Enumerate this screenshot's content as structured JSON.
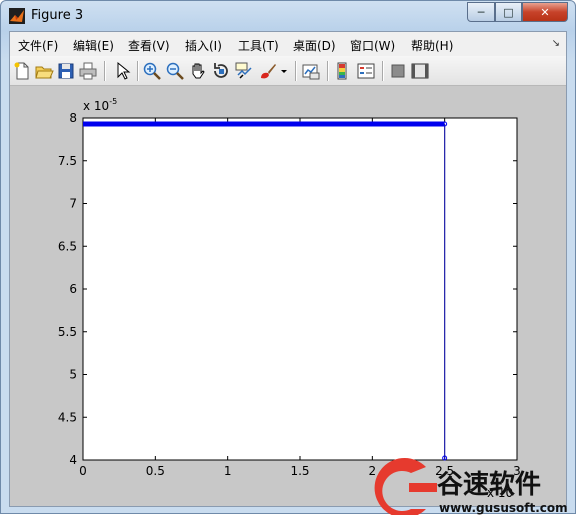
{
  "window": {
    "title": "Figure 3",
    "controls": {
      "minimize": "─",
      "maximize": "□",
      "close": "✕"
    }
  },
  "menu": {
    "items": [
      "文件(F)",
      "编辑(E)",
      "查看(V)",
      "插入(I)",
      "工具(T)",
      "桌面(D)",
      "窗口(W)",
      "帮助(H)"
    ],
    "overflow_icon": "dock-arrow-icon"
  },
  "toolbar": {
    "buttons": [
      "new-figure-icon",
      "open-file-icon",
      "save-icon",
      "print-icon",
      "edit-plot-arrow-icon",
      "zoom-in-icon",
      "zoom-out-icon",
      "pan-hand-icon",
      "rotate-3d-icon",
      "data-cursor-icon",
      "brush-icon",
      "link-plot-icon",
      "colorbar-icon",
      "legend-icon",
      "hide-plot-tools-icon",
      "show-plot-tools-icon"
    ]
  },
  "colors": {
    "plot_line": "#0000ee",
    "axes_bg": "#ffffff",
    "figure_bg": "#c8c8c8"
  },
  "chart_data": {
    "type": "line",
    "x_exponent_label": "x 10",
    "y_exponent_label": "x 10",
    "y_exponent_sup": "-5",
    "xlim": [
      0,
      3
    ],
    "ylim": [
      4,
      8
    ],
    "x_ticks": [
      0,
      0.5,
      1,
      1.5,
      2,
      2.5,
      3
    ],
    "x_tick_labels": [
      "0",
      "0.5",
      "1",
      "1.5",
      "2",
      "2.5",
      "3"
    ],
    "y_ticks": [
      4,
      4.5,
      5,
      5.5,
      6,
      6.5,
      7,
      7.5,
      8
    ],
    "y_tick_labels": [
      "4",
      "4.5",
      "5",
      "5.5",
      "6",
      "6.5",
      "7",
      "7.5",
      "8"
    ],
    "series": [
      {
        "x": [
          0,
          2.5,
          2.5,
          2.5
        ],
        "y": [
          7.93,
          7.93,
          7.93,
          4.0
        ]
      }
    ]
  },
  "watermark": {
    "brand": "谷速软件",
    "url": "www.gususoft.com"
  }
}
